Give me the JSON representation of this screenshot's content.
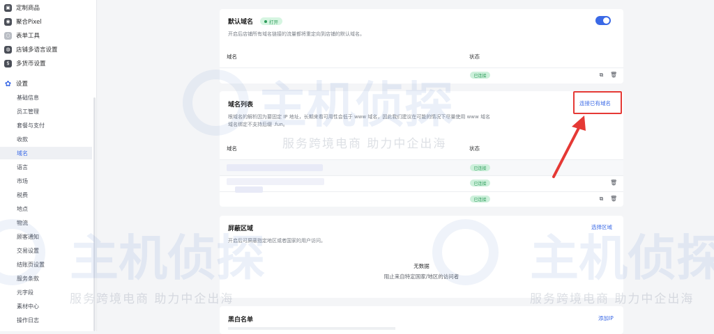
{
  "sidebar": {
    "top_items": [
      {
        "label": "定制商品",
        "icon": "custom-product-icon"
      },
      {
        "label": "聚合Pixel",
        "icon": "pixel-icon"
      },
      {
        "label": "表单工具",
        "icon": "form-tool-icon"
      },
      {
        "label": "店铺多语言设置",
        "icon": "globe-icon"
      },
      {
        "label": "多货币设置",
        "icon": "currency-icon"
      }
    ],
    "settings_label": "设置",
    "sub_items": [
      "基础信息",
      "员工管理",
      "套餐与支付",
      "收款",
      "域名",
      "语言",
      "市场",
      "税费",
      "地点",
      "物流",
      "顾客通知",
      "交易设置",
      "结账页设置",
      "服务条款",
      "元字段",
      "素材中心",
      "操作日志"
    ],
    "active_index": 4
  },
  "default_domain": {
    "title": "默认域名",
    "badge": "打开",
    "desc": "开启后店铺所有域名链接的流量都将重定向到店铺的默认域名。",
    "col_domain": "域名",
    "col_status": "状态",
    "row_status": "已连接",
    "toggle_on": true
  },
  "domain_list": {
    "title": "域名列表",
    "link": "连接已有域名",
    "desc_line1": "根域名的解析因为要固定 IP 地址，长期来看可用性会低于 www 域名，因此我们建议在可能的情况下尽量使用 www 域名",
    "desc_line2": "域名绑定不支持后缀 .fun。",
    "col_domain": "域名",
    "col_status": "状态",
    "rows": [
      "已连接",
      "已连接",
      "已连接"
    ]
  },
  "blocked_region": {
    "title": "屏蔽区域",
    "link": "选择区域",
    "desc": "开启后可屏蔽指定地区或者国家的用户访问。",
    "empty_title": "无数据",
    "empty_desc": "阻止来自特定国家/地区的访问者"
  },
  "blacklist": {
    "title": "黑白名单",
    "link": "添加IP"
  },
  "watermark": {
    "brand": "主机侦探",
    "slogan": "服务跨境电商 助力中企出海"
  },
  "colors": {
    "accent": "#3a69e6",
    "success": "#2e9c5b",
    "annotation": "#e53935"
  }
}
